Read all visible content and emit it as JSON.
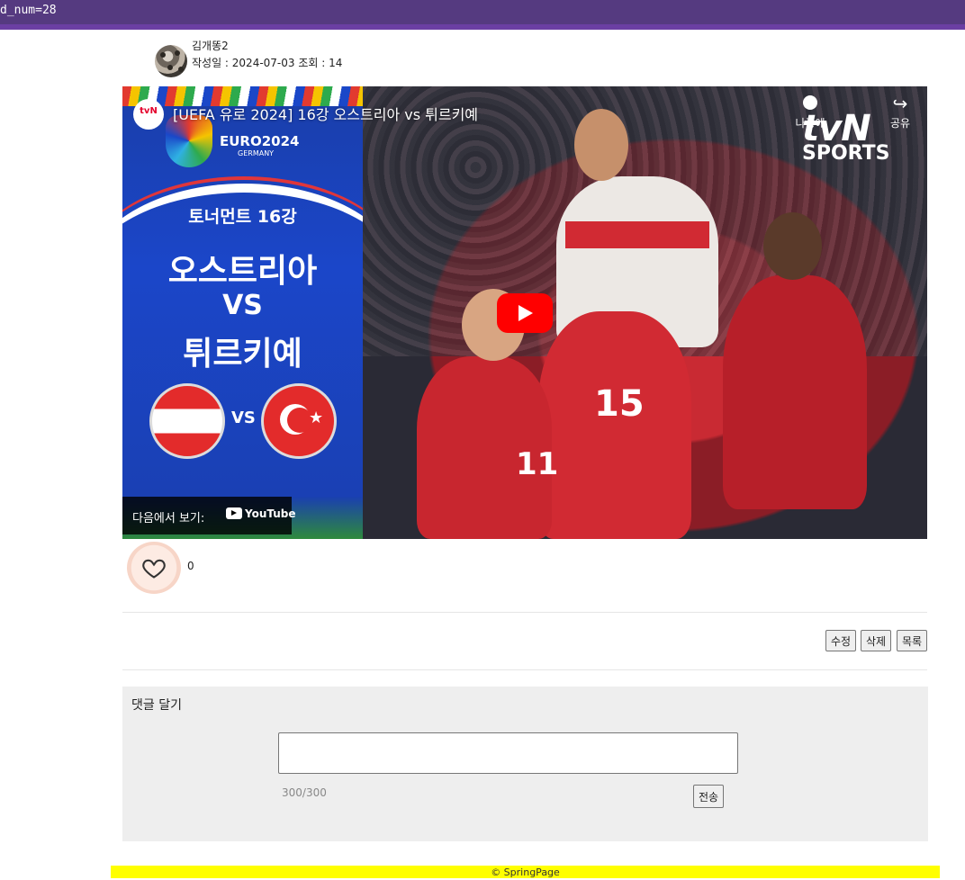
{
  "browser": {
    "url_fragment": "d_num=28"
  },
  "post": {
    "author": "김개똥2",
    "meta": "작성일 : 2024-07-03 조회 : 14",
    "likes": "0"
  },
  "video": {
    "title": "[UEFA 유로 2024] 16강 오스트리아 vs 튀르키예",
    "channel_badge": "tvN",
    "watch_later": "나중에",
    "share": "공유",
    "logo_main": "tvN",
    "logo_sub": "SPORTS",
    "thumb": {
      "euro": "EURO2024",
      "euro_sub": "GERMANY",
      "round": "토너먼트 16강",
      "team1": "오스트리아",
      "vs": "VS",
      "team2": "튀르키예",
      "flag_vs": "VS",
      "num1": "15",
      "num2": "11"
    },
    "watch_on": "다음에서 보기:",
    "youtube": "YouTube"
  },
  "actions": {
    "edit": "수정",
    "delete": "삭제",
    "list": "목록"
  },
  "comment": {
    "title": "댓글 달기",
    "input_value": "",
    "counter": "300/300",
    "send": "전송"
  },
  "footer": {
    "text": "© SpringPage"
  },
  "colors": {
    "topbar": "#553a80",
    "footer": "#ffff00",
    "play": "#ff0000",
    "comment_bg": "#eeeeee"
  },
  "icons": [
    "heart-icon",
    "play-icon",
    "clock-icon",
    "share-icon",
    "youtube-icon"
  ]
}
